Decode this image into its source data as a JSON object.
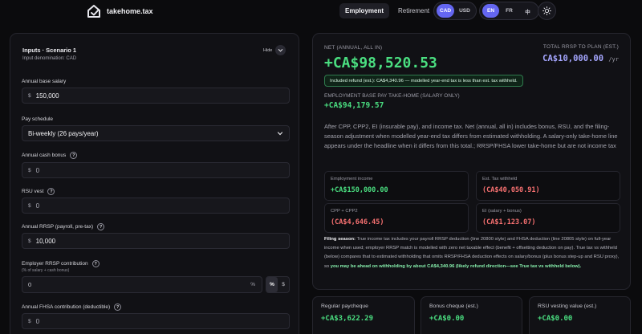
{
  "header": {
    "brand": "takehome.tax",
    "tabs": [
      {
        "label": "Employment",
        "active": true
      },
      {
        "label": "Retirement",
        "active": false
      }
    ],
    "currency": [
      "CAD",
      "USD"
    ],
    "currency_selected": "CAD",
    "languages": [
      "EN",
      "FR",
      "中"
    ],
    "language_selected": "EN",
    "theme_icon": "sun-icon"
  },
  "inputs": {
    "title": "Inputs · Scenario 1",
    "denomination": "Input denomination: CAD",
    "hide_label": "Hide",
    "currency_symbol": "$",
    "percent_symbol": "%",
    "base_salary": {
      "label": "Annual base salary",
      "value": "150,000"
    },
    "pay_schedule": {
      "label": "Pay schedule",
      "value": "Bi-weekly (26 pays/year)"
    },
    "cash_bonus": {
      "label": "Annual cash bonus",
      "placeholder": "0"
    },
    "rsu_vest": {
      "label": "RSU vest",
      "placeholder": "0"
    },
    "rrsp_payroll": {
      "label": "Annual RRSP (payroll, pre-tax)",
      "value": "10,000"
    },
    "employer_rrsp": {
      "label": "Employer RRSP contribution",
      "sub": "(% of salary + cash bonus)",
      "placeholder": "0",
      "modes": [
        "%",
        "$"
      ],
      "mode_selected": "%"
    },
    "fhsa": {
      "label": "Annual FHSA contribution (deductible)",
      "placeholder": "0"
    }
  },
  "summary": {
    "net_label": "NET (ANNUAL, ALL IN)",
    "net_value": "+CA$98,520.53",
    "rrsp_plan_label": "TOTAL RRSP TO PLAN (EST.)",
    "rrsp_plan_value": "CA$10,000.00",
    "rrsp_plan_unit": "/yr",
    "refund_badge": "Included refund (est.): CA$4,340.96 — modelled year-end tax is less than est. tax withheld.",
    "employment_label": "EMPLOYMENT BASE PAY TAKE-HOME (SALARY ONLY)",
    "employment_value": "+CA$94,179.57",
    "description": "After CPP, CPP2, EI (insurable pay), and income tax. Net (annual, all in) includes bonus, RSU, and the filing-season adjustment when modelled year-end tax differs from estimated withholding. A salary-only take-home line appears under the headline when it differs from this total.; RRSP/FHSA lower take-home but are not income tax",
    "cards": [
      {
        "label": "Employment income",
        "value": "+CA$150,000.00",
        "tone": "green"
      },
      {
        "label": "Est. Tax withheld",
        "value": "(CA$40,050.91)",
        "tone": "red"
      },
      {
        "label": "CPP + CPP2",
        "value": "(CA$4,646.45)",
        "tone": "red"
      },
      {
        "label": "EI (salary + bonus)",
        "value": "(CA$1,123.07)",
        "tone": "red"
      }
    ],
    "filing_title": "Filing season:",
    "filing_text": " True income tax includes your payroll RRSP deduction (line 20800 style) and FHSA deduction (line 20805 style) on full-year income when used; employer RRSP match is modelled with zero net taxable effect (benefit + offsetting deduction on pay). True tax vs withheld (below) compares that to estimated withholding that omits RRSP/FHSA deduction effects on salary/bonus (plus bonus step-up and RSU proxy), so ",
    "filing_highlight": "you may be ahead on withholding by about CA$4,340.96 (likely refund direction—see True tax vs withheld below)."
  },
  "bottom_cards": [
    {
      "label": "Regular paycheque",
      "value": "+CA$3,622.29"
    },
    {
      "label": "Bonus cheque (est.)",
      "value": "+CA$0.00"
    },
    {
      "label": "RSU vesting value (est.)",
      "value": "+CA$0.00"
    }
  ],
  "colors": {
    "accent": "#6466f1",
    "positive": "#4ade80",
    "negative": "#f87171",
    "rrsp": "#a5a6ff"
  }
}
